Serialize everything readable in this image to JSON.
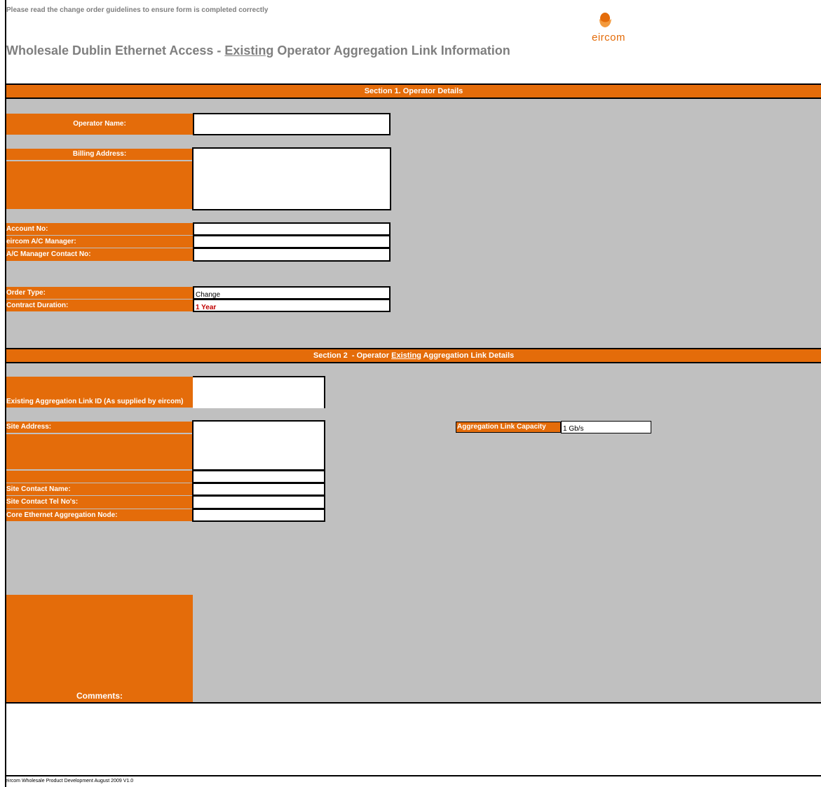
{
  "notice": "Please read the change order guidelines to ensure form is completed correctly",
  "title": {
    "prefix": "Wholesale Dublin Ethernet Access - ",
    "emphasis": "Existing",
    "suffix": " Operator Aggregation Link Information"
  },
  "brand": {
    "name": "eircom",
    "color": "#e46c0a"
  },
  "section1": {
    "header": "Section 1. Operator Details",
    "operator_name_label": "Operator Name:",
    "operator_name_value": "",
    "billing_address_label": "Billing Address:",
    "billing_address_value": "",
    "account_no_label": "Account No:",
    "account_no_value": "",
    "ac_manager_label": "eircom A/C Manager:",
    "ac_manager_value": "",
    "ac_manager_contact_label": "A/C Manager Contact No:",
    "ac_manager_contact_value": "",
    "order_type_label": "Order Type:",
    "order_type_value": "Change",
    "contract_duration_label": "Contract Duration:",
    "contract_duration_value": "1 Year"
  },
  "section2": {
    "header_prefix": "Section 2  - Operator ",
    "header_emphasis": "Existing",
    "header_suffix": " Aggregation Link Details",
    "link_id_label": "Existing Aggregation Link ID (As supplied by eircom)",
    "link_id_value": "",
    "site_address_label": "Site Address:",
    "site_address_value": "",
    "site_contact_name_label": "Site Contact Name:",
    "site_contact_name_value": "",
    "site_contact_tel_label": "Site Contact Tel No's:",
    "site_contact_tel_value": "",
    "core_node_label": "Core Ethernet Aggregation Node:",
    "core_node_value": "",
    "capacity_label": "Aggregation Link Capacity",
    "capacity_value": "1 Gb/s"
  },
  "comments": {
    "label": "Comments:",
    "value": ""
  },
  "footer": "eircom Wholesale Product Development August 2009 V1.0",
  "colors": {
    "accent": "#e46c0a",
    "panel": "#c0c0c0",
    "heading_text": "#7f7f7f",
    "highlight_text": "#c00000"
  }
}
